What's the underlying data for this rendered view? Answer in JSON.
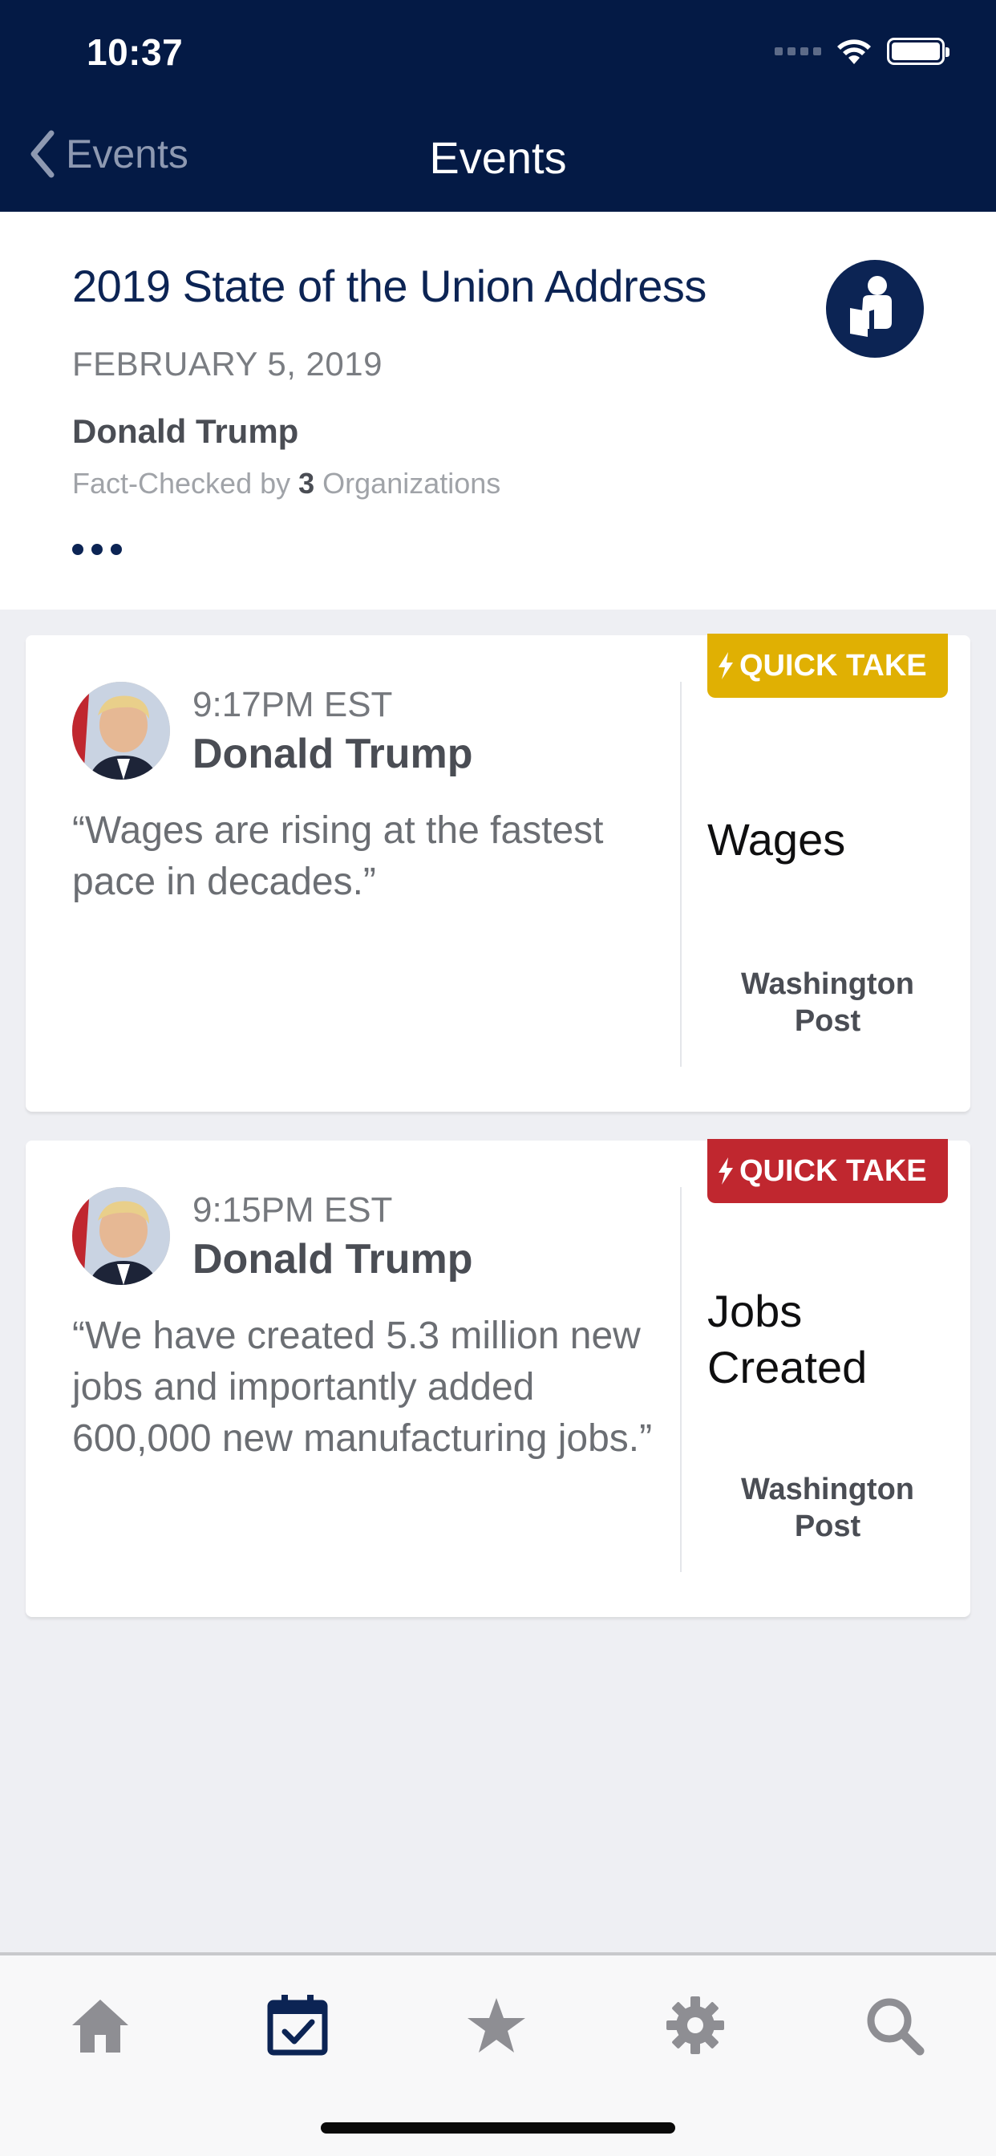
{
  "status_bar": {
    "time": "10:37"
  },
  "nav": {
    "back_label": "Events",
    "title": "Events"
  },
  "event": {
    "title": "2019 State of the Union Address",
    "date": "FEBRUARY 5, 2019",
    "speaker": "Donald Trump",
    "fact_checked_prefix": "Fact-Checked by",
    "fact_checked_count": "3",
    "fact_checked_suffix": "Organizations"
  },
  "cards": [
    {
      "time": "9:17PM EST",
      "speaker": "Donald Trump",
      "quote": "“Wages are rising at the fastest pace in decades.”",
      "badge_label": "QUICK TAKE",
      "badge_color": "#e0b003",
      "topic": "Wages",
      "source": "Washington Post"
    },
    {
      "time": "9:15PM EST",
      "speaker": "Donald Trump",
      "quote": "“We have created 5.3 million new jobs and importantly added 600,000 new manufacturing jobs.”",
      "badge_label": "QUICK TAKE",
      "badge_color": "#c0272f",
      "topic": "Jobs Created",
      "source": "Washington Post"
    }
  ],
  "tabs": [
    {
      "icon": "home-icon"
    },
    {
      "icon": "calendar-check-icon",
      "selected": true
    },
    {
      "icon": "star-icon"
    },
    {
      "icon": "gear-icon"
    },
    {
      "icon": "search-icon"
    }
  ],
  "colors": {
    "header_bg": "#041a45",
    "accent": "#0c2454",
    "quick_take_yellow": "#e0b003",
    "quick_take_red": "#c0272f"
  }
}
